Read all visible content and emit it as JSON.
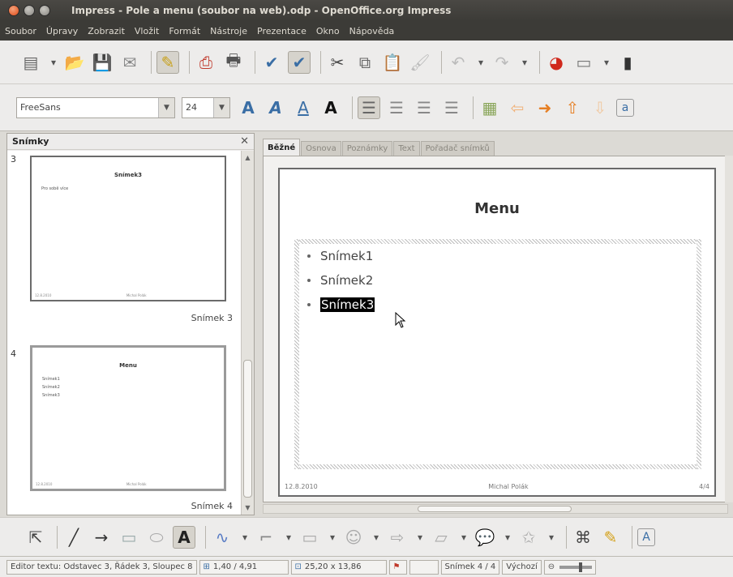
{
  "window": {
    "title": "Impress - Pole a menu (soubor na web).odp - OpenOffice.org Impress"
  },
  "menu": [
    "Soubor",
    "Úpravy",
    "Zobrazit",
    "Vložit",
    "Formát",
    "Nástroje",
    "Prezentace",
    "Okno",
    "Nápověda"
  ],
  "format_toolbar": {
    "font_name": "FreeSans",
    "font_size": "24"
  },
  "slides_panel": {
    "title": "Snímky",
    "slides": [
      {
        "number": "3",
        "label": "Snímek 3",
        "title": "Snímek3",
        "items": [
          "Pro sobě více"
        ],
        "footer_left": "12.8.2010",
        "footer_center": "Michal Polák"
      },
      {
        "number": "4",
        "label": "Snímek 4",
        "title": "Menu",
        "items": [
          "Snímek1",
          "Snímek2",
          "Snímek3"
        ],
        "footer_left": "12.8.2010",
        "footer_center": "Michal Polák"
      }
    ]
  },
  "view_tabs": [
    "Běžné",
    "Osnova",
    "Poznámky",
    "Text",
    "Pořadač snímků"
  ],
  "slide": {
    "title": "Menu",
    "bullets": [
      "Snímek1",
      "Snímek2",
      "Snímek3"
    ],
    "selected_bullet_index": 2,
    "footer_date": "12.8.2010",
    "footer_author": "Michal Polák",
    "footer_page": "4/4"
  },
  "status": {
    "edit_info": "Editor textu: Odstavec 3, Řádek 3, Sloupec 8",
    "position": "1,40 / 4,91",
    "size": "25,20 x 13,86",
    "slide_counter": "Snímek 4 / 4",
    "layout": "Výchozí"
  }
}
